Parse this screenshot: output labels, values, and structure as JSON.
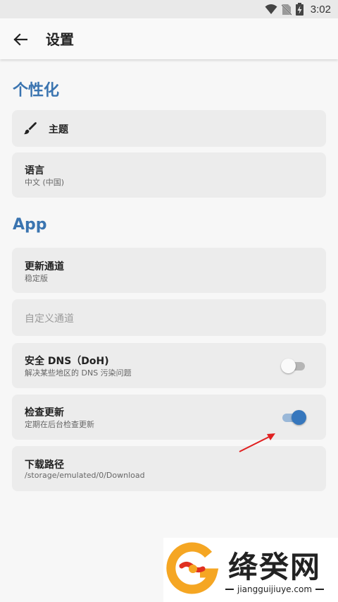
{
  "status_bar": {
    "time": "3:02"
  },
  "app_bar": {
    "title": "设置"
  },
  "sections": {
    "personalization": {
      "title": "个性化"
    },
    "app": {
      "title": "App"
    }
  },
  "items": {
    "theme": {
      "title": "主题",
      "icon": "brush-icon"
    },
    "language": {
      "title": "语言",
      "subtitle": "中文 (中国)"
    },
    "update_channel": {
      "title": "更新通道",
      "subtitle": "稳定版"
    },
    "custom_channel": {
      "title": "自定义通道"
    },
    "secure_dns": {
      "title": "安全 DNS（DoH)",
      "subtitle": "解决某些地区的 DNS 污染问题",
      "enabled": false
    },
    "check_updates": {
      "title": "检查更新",
      "subtitle": "定期在后台检查更新",
      "enabled": true
    },
    "download_path": {
      "title": "下载路径",
      "subtitle": "/storage/emulated/0/Download"
    }
  },
  "watermark": {
    "name": "绛癸网",
    "url": "jiangguijiuye.com"
  },
  "colors": {
    "accent": "#3a74b0",
    "switch_on_thumb": "#3677bd",
    "switch_on_track": "#9ab8d8",
    "switch_off_thumb": "#fafafa",
    "switch_off_track": "#b5b5b5",
    "annotation_arrow": "#e02020"
  }
}
